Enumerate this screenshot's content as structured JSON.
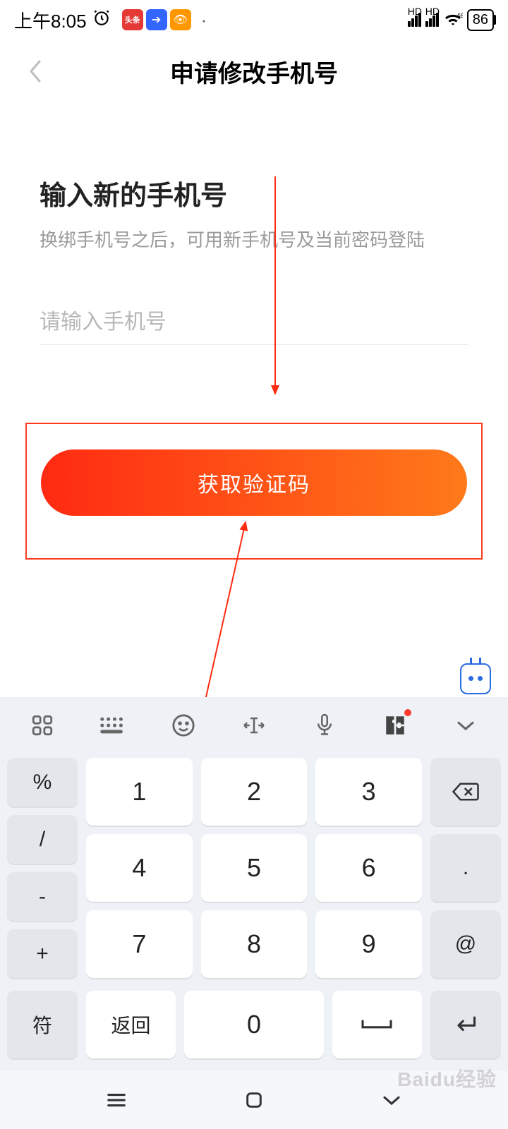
{
  "status": {
    "time": "上午8:05",
    "battery": "86",
    "hd_label": "HD"
  },
  "header": {
    "title": "申请修改手机号"
  },
  "content": {
    "heading": "输入新的手机号",
    "subtext": "换绑手机号之后，可用新手机号及当前密码登陆",
    "placeholder": "请输入手机号",
    "button_label": "获取验证码"
  },
  "keyboard": {
    "side_left": [
      "%",
      "/",
      "-",
      "+"
    ],
    "numbers": [
      [
        "1",
        "2",
        "3"
      ],
      [
        "4",
        "5",
        "6"
      ],
      [
        "7",
        "8",
        "9"
      ]
    ],
    "side_right_dot": ".",
    "side_right_at": "@",
    "bottom_sym": "符",
    "bottom_return": "返回",
    "bottom_zero": "0"
  },
  "watermark": "Baidu经验"
}
